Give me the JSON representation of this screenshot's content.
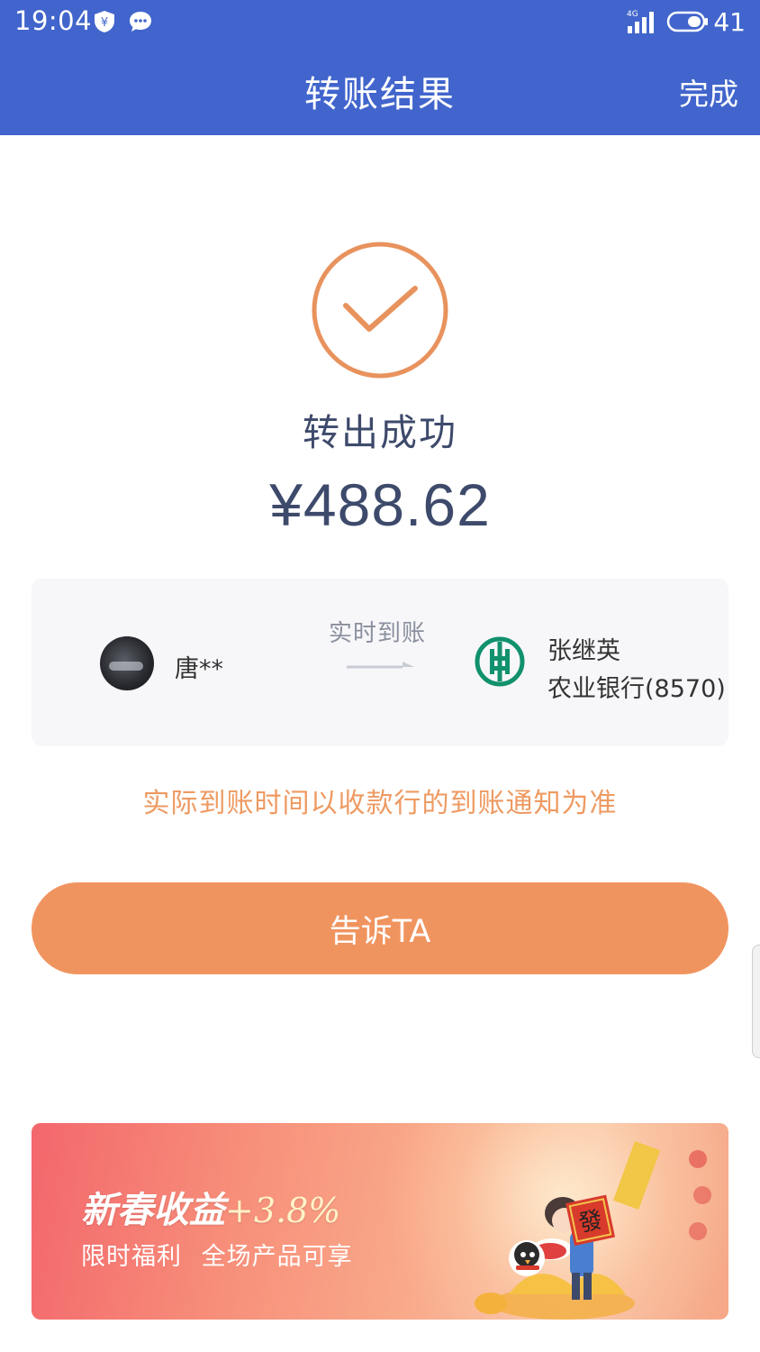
{
  "status_bar": {
    "time": "19:04",
    "network": "4G",
    "battery": "41"
  },
  "nav": {
    "title": "转账结果",
    "done": "完成"
  },
  "result": {
    "status": "转出成功",
    "amount": "¥488.62"
  },
  "transfer": {
    "sender": "唐**",
    "mode": "实时到账",
    "receiver_name": "张继英",
    "receiver_bank": "农业银行(8570)"
  },
  "notice": "实际到账时间以收款行的到账通知为准",
  "tell_button": "告诉TA",
  "banner": {
    "title": "新春收益",
    "rate": "+3.8%",
    "subtitle": "限时福利 全场产品可享",
    "art_text": "發"
  },
  "colors": {
    "header": "#4165cc",
    "accent": "#f0945f",
    "check": "#e8925d",
    "text_dark": "#3e4a6b",
    "bank_green": "#11916d"
  }
}
